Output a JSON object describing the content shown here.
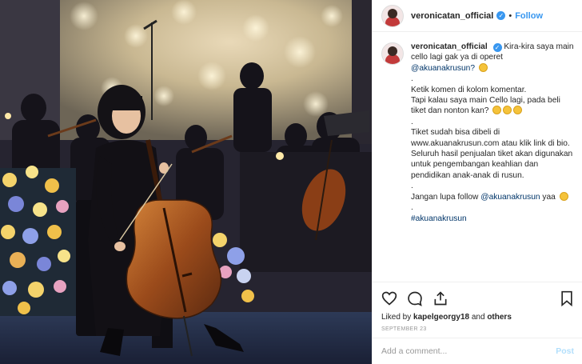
{
  "post": {
    "username": "veronicatan_official",
    "follow_label": "Follow",
    "dot": "•",
    "verified_glyph": "✓"
  },
  "caption": {
    "username": "veronicatan_official",
    "lines": [
      "Kira-kira saya main cello lagi gak ya di operet",
      "@akuanakrusun?",
      ".",
      "Ketik komen di kolom komentar.",
      "Tapi kalau saya main Cello lagi, pada beli tiket dan nonton kan?",
      ".",
      "Tiket sudah bisa dibeli di www.akuanakrusun.com atau klik link di bio.",
      "Seluruh hasil penjualan tiket akan digunakan untuk pengembangan keahlian dan pendidikan anak-anak di rusun.",
      ".",
      "Jangan lupa follow",
      "@akuanakrusun",
      "yaa",
      ".",
      "#akuanakrusun"
    ]
  },
  "actions": {
    "liked_prefix": "Liked by",
    "liked_user": "kapelgeorgy18",
    "liked_and": "and",
    "liked_others": "others",
    "date": "SEPTEMBER 23"
  },
  "comment_box": {
    "placeholder": "Add a comment...",
    "post_label": "Post"
  },
  "icons": {
    "like": "heart-icon",
    "comment": "comment-icon",
    "share": "share-icon",
    "save": "bookmark-icon"
  }
}
